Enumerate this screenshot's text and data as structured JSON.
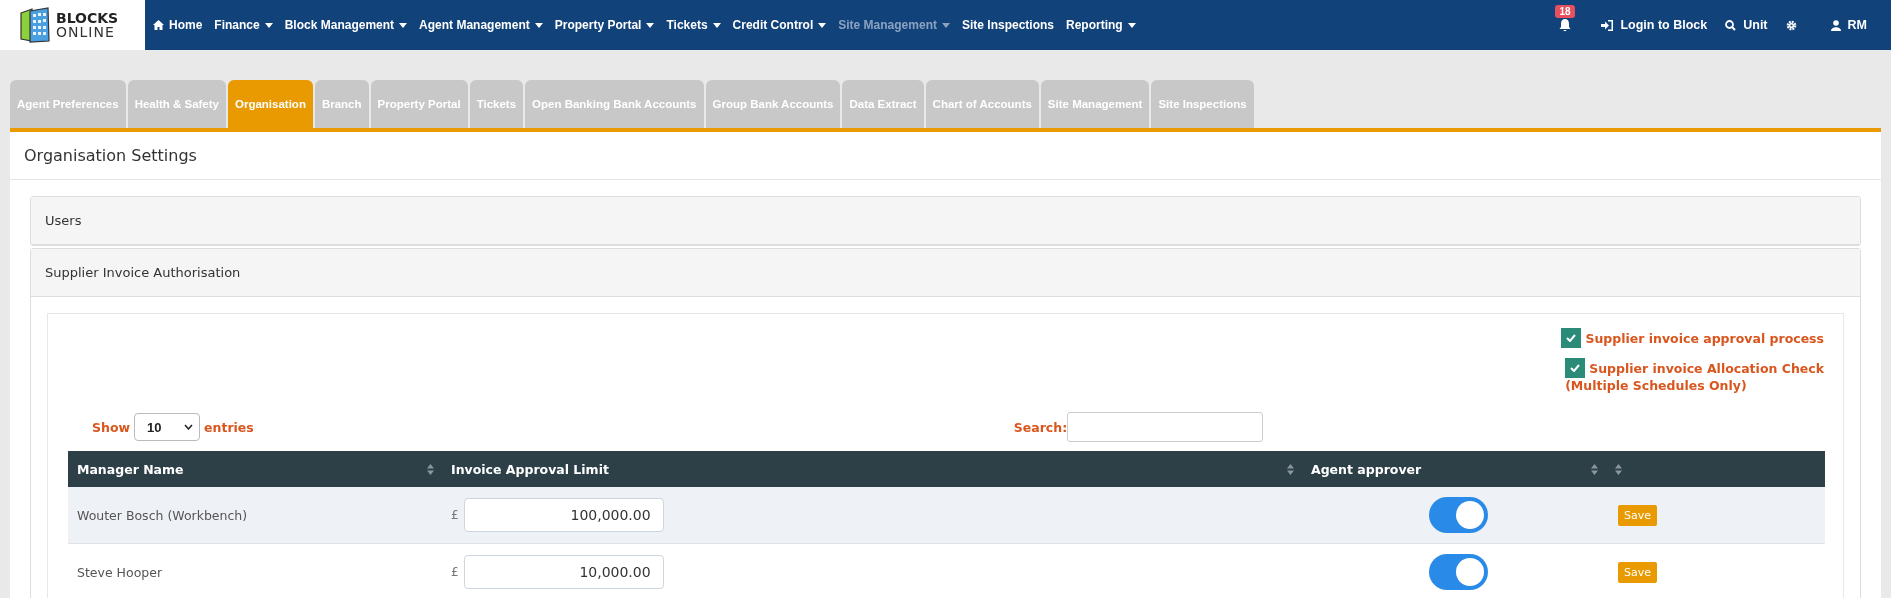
{
  "logo": {
    "line1": "BLOCKS",
    "line2": "ONLINE"
  },
  "nav": [
    {
      "label": "Home",
      "kind": "home",
      "dropdown": false,
      "disabled": false
    },
    {
      "label": "Finance",
      "dropdown": true,
      "disabled": false
    },
    {
      "label": "Block Management",
      "dropdown": true,
      "disabled": false
    },
    {
      "label": "Agent Management",
      "dropdown": true,
      "disabled": false
    },
    {
      "label": "Property Portal",
      "dropdown": true,
      "disabled": false
    },
    {
      "label": "Tickets",
      "dropdown": true,
      "disabled": false
    },
    {
      "label": "Credit Control",
      "dropdown": true,
      "disabled": false
    },
    {
      "label": "Site Management",
      "dropdown": true,
      "disabled": true
    },
    {
      "label": "Site Inspections",
      "dropdown": false,
      "disabled": false
    },
    {
      "label": "Reporting",
      "dropdown": true,
      "disabled": false
    }
  ],
  "notifications": {
    "count": "18"
  },
  "nav_right": [
    {
      "kind": "login",
      "label": "Login to Block"
    },
    {
      "kind": "search",
      "label": "Unit"
    },
    {
      "kind": "settings"
    },
    {
      "kind": "user",
      "label": "RM"
    }
  ],
  "tabs": [
    {
      "label": "Agent Preferences",
      "selected": false
    },
    {
      "label": "Health & Safety",
      "selected": false
    },
    {
      "label": "Organisation",
      "selected": true
    },
    {
      "label": "Branch",
      "selected": false
    },
    {
      "label": "Property Portal",
      "selected": false
    },
    {
      "label": "Tickets",
      "selected": false
    },
    {
      "label": "Open Banking Bank Accounts",
      "selected": false
    },
    {
      "label": "Group Bank Accounts",
      "selected": false
    },
    {
      "label": "Data Extract",
      "selected": false
    },
    {
      "label": "Chart of Accounts",
      "selected": false
    },
    {
      "label": "Site Management",
      "selected": false
    },
    {
      "label": "Site Inspections",
      "selected": false
    }
  ],
  "page_title": "Organisation Settings",
  "sections": [
    {
      "title": "Users",
      "expanded": false
    },
    {
      "title": "Supplier Invoice Authorisation",
      "expanded": true
    }
  ],
  "options": [
    {
      "label": "Supplier invoice approval process",
      "checked": true
    },
    {
      "label": "Supplier invoice Allocation Check",
      "note": "(Multiple Schedules Only)",
      "checked": true
    }
  ],
  "table": {
    "show_label": "Show",
    "page_size": "10",
    "entries_label": "entries",
    "search_label": "Search:",
    "columns": [
      {
        "label": "Manager Name",
        "sortable": true
      },
      {
        "label": "Invoice Approval Limit",
        "sortable": true
      },
      {
        "label": "Agent approver",
        "sortable": true
      },
      {
        "sortable": true
      }
    ],
    "rows": [
      {
        "manager": "Wouter Bosch (Workbench)",
        "currency": "£",
        "limit": "100,000.00",
        "approver": true,
        "action": "Save"
      },
      {
        "manager": "Steve Hooper",
        "currency": "£",
        "limit": "10,000.00",
        "approver": true,
        "action": "Save"
      }
    ]
  }
}
